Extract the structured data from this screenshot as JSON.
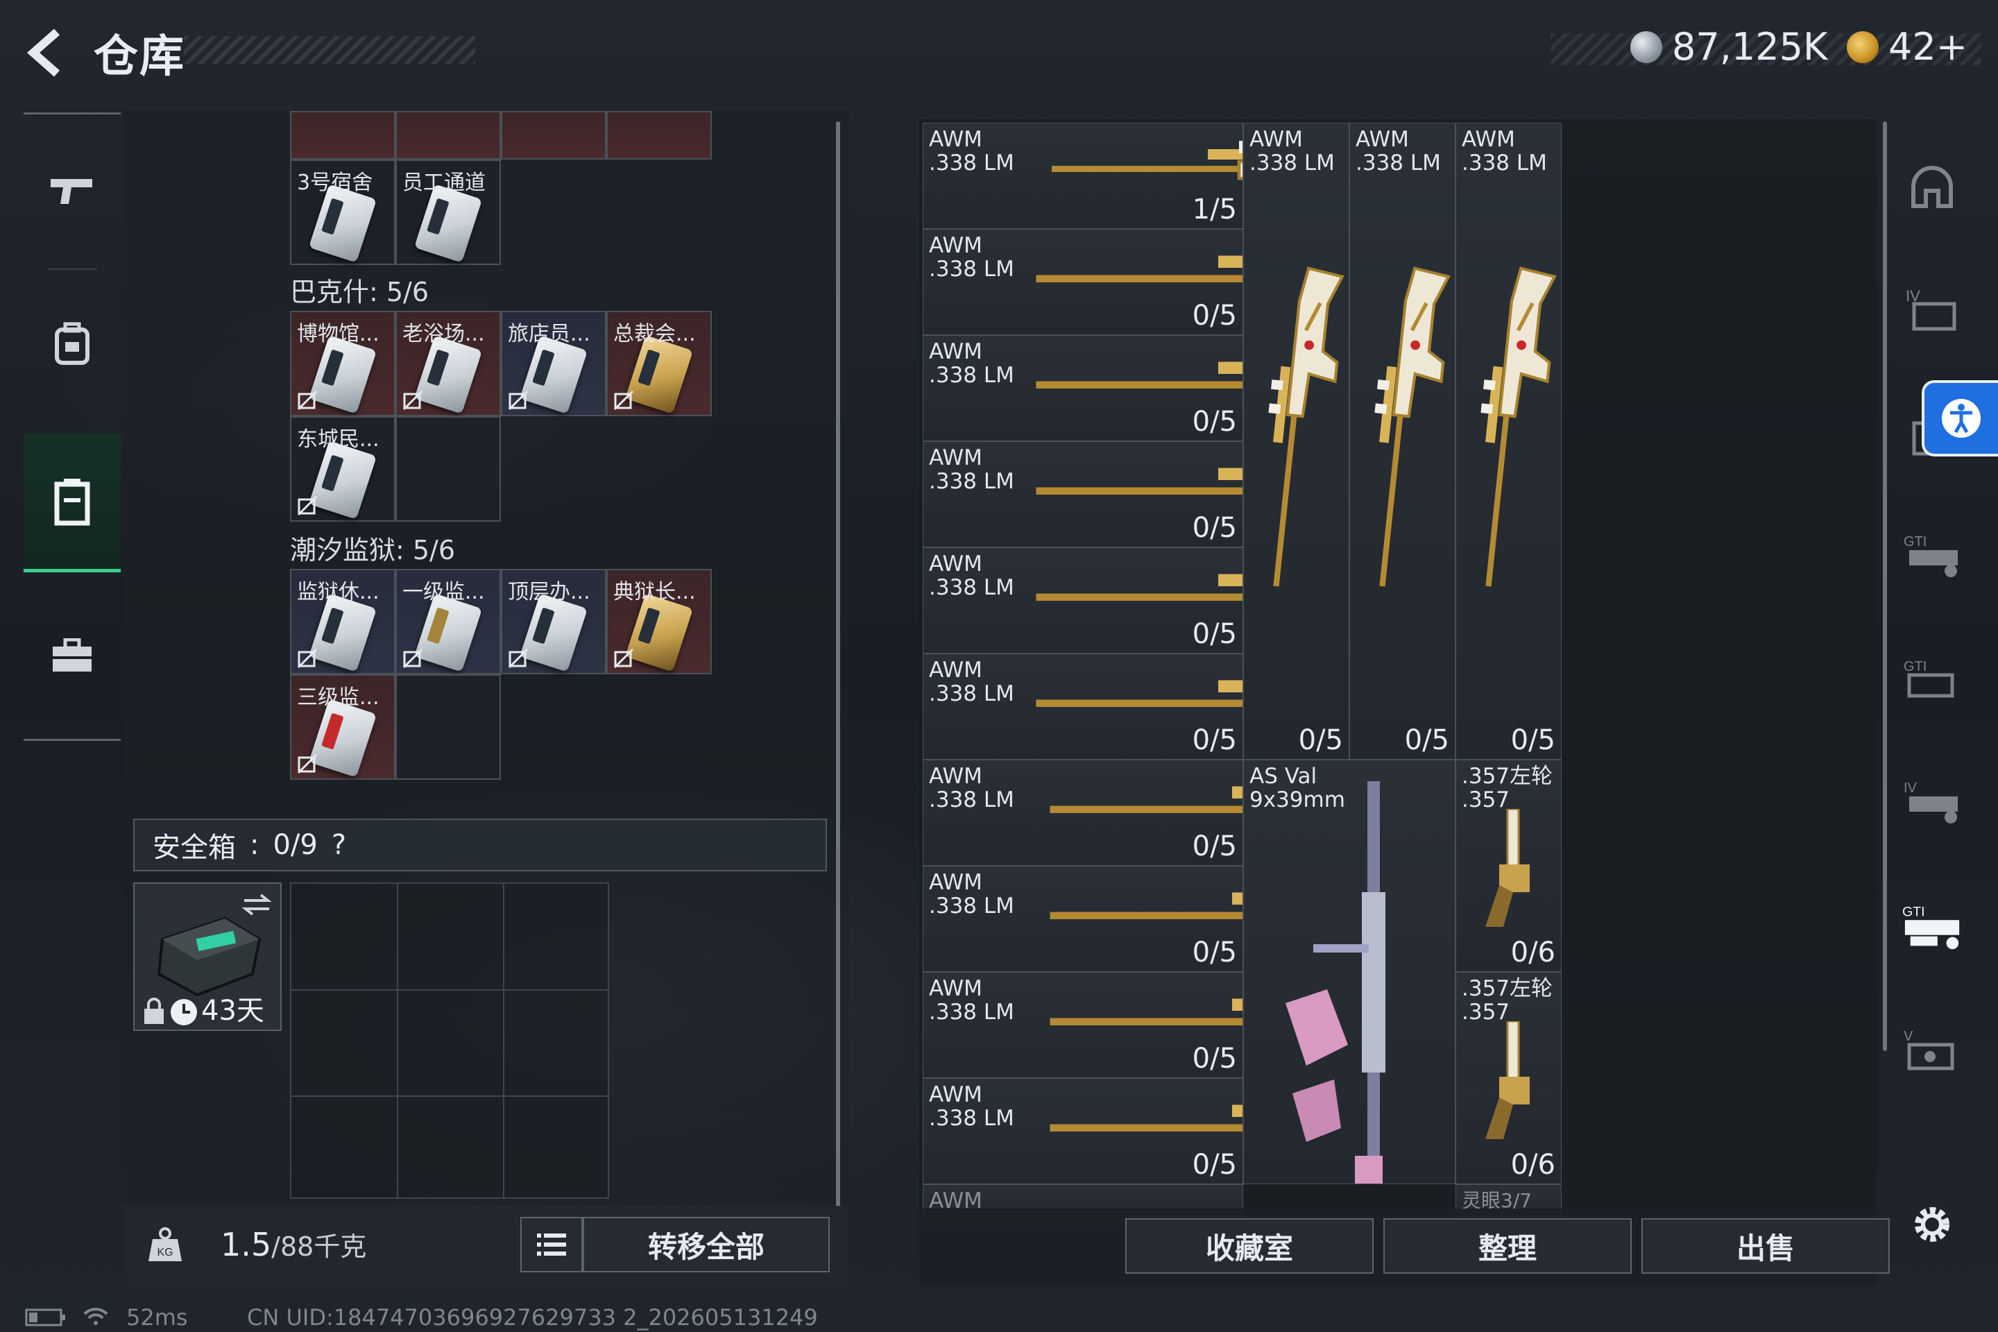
{
  "header": {
    "title": "仓库"
  },
  "currency": {
    "hafu_coin": "87,125K",
    "tickets": "42+",
    "coin_color": "#a9b3bd",
    "ticket_color": "#d9a634"
  },
  "left_nav": {
    "items": [
      "gun-icon",
      "backpack-icon",
      "container-icon",
      "briefcase-icon"
    ],
    "active": "container-icon"
  },
  "containers": {
    "top_row_labels": [
      "",
      "",
      "",
      ""
    ],
    "row2_labels": [
      "3号宿舍",
      "员工通道"
    ],
    "section_bakeshi": "巴克什: 5/6",
    "bakeshi_labels": [
      "博物馆...",
      "老浴场...",
      "旅店员...",
      "总裁会...",
      "东城民..."
    ],
    "section_prison": "潮汐监狱: 5/6",
    "prison_labels": [
      "监狱休...",
      "一级监...",
      "顶层办...",
      "典狱长...",
      "三级监..."
    ]
  },
  "safe": {
    "label": "安全箱",
    "value": "0/9",
    "help": "?",
    "days": "43天"
  },
  "bottom_left": {
    "weight": "1.5",
    "capacity": "/88千克",
    "transfer_all": "转移全部"
  },
  "stash": {
    "awm_name": "AWM\n.338 LM",
    "awm_row_counts": [
      "1/5",
      "0/5",
      "0/5",
      "0/5",
      "0/5",
      "0/5",
      "0/5",
      "0/5",
      "0/5",
      "0/5"
    ],
    "vertical_counts": [
      "0/5",
      "0/5",
      "0/5"
    ],
    "asval_name": "AS Val\n9x39mm",
    "revolver_name": ".357左轮\n.357",
    "revolver_counts": [
      "0/6",
      "0/6"
    ],
    "partial_awm": "AWM",
    "partial_right": "灵眼3/7"
  },
  "bottom_right": {
    "collection": "收藏室",
    "sort": "整理",
    "sell": "出售"
  },
  "right_tabs": [
    "helmet-icon",
    "armor-iv-icon",
    "armor-gti-icon",
    "vest-gti-icon",
    "vest-gti2-icon",
    "vest-iv-icon",
    "vest-gti-active-icon",
    "vest-v-icon"
  ],
  "status": {
    "ping": "52ms",
    "uid": "CN UID:18474703696927629733 2_202605131249"
  }
}
